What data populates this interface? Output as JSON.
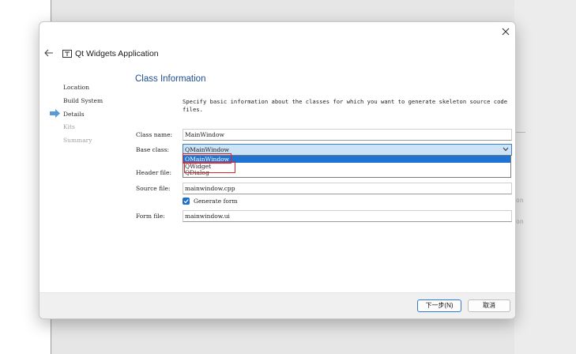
{
  "background": {
    "ghost_text_1": "on",
    "ghost_text_2": "on"
  },
  "dialog": {
    "title": "Qt Widgets Application",
    "close_icon": "close-icon",
    "back_icon": "back-arrow-icon",
    "wizard_icon": "qt-widgets-icon"
  },
  "steps": [
    {
      "label": "Location",
      "state": "done"
    },
    {
      "label": "Build System",
      "state": "done"
    },
    {
      "label": "Details",
      "state": "current"
    },
    {
      "label": "Kits",
      "state": "disabled"
    },
    {
      "label": "Summary",
      "state": "disabled"
    }
  ],
  "page": {
    "title": "Class Information",
    "description": "Specify basic information about the classes for which you want to generate skeleton source code files."
  },
  "form": {
    "class_name_label": "Class name:",
    "class_name_value": "MainWindow",
    "base_class_label": "Base class:",
    "base_class_value": "QMainWindow",
    "base_class_options": [
      "QMainWindow",
      "QWidget",
      "QDialog"
    ],
    "header_file_label": "Header file:",
    "source_file_label": "Source file:",
    "source_file_value": "mainwindow.cpp",
    "generate_form_label": "Generate form",
    "generate_form_checked": true,
    "form_file_label": "Form file:",
    "form_file_value": "mainwindow.ui"
  },
  "footer": {
    "next_label": "下一步(N)",
    "cancel_label": "取消"
  },
  "colors": {
    "accent": "#1f73d4",
    "title_blue": "#1f4e8f",
    "highlight_red": "#e0242a",
    "combo_bg": "#cde4f7"
  }
}
